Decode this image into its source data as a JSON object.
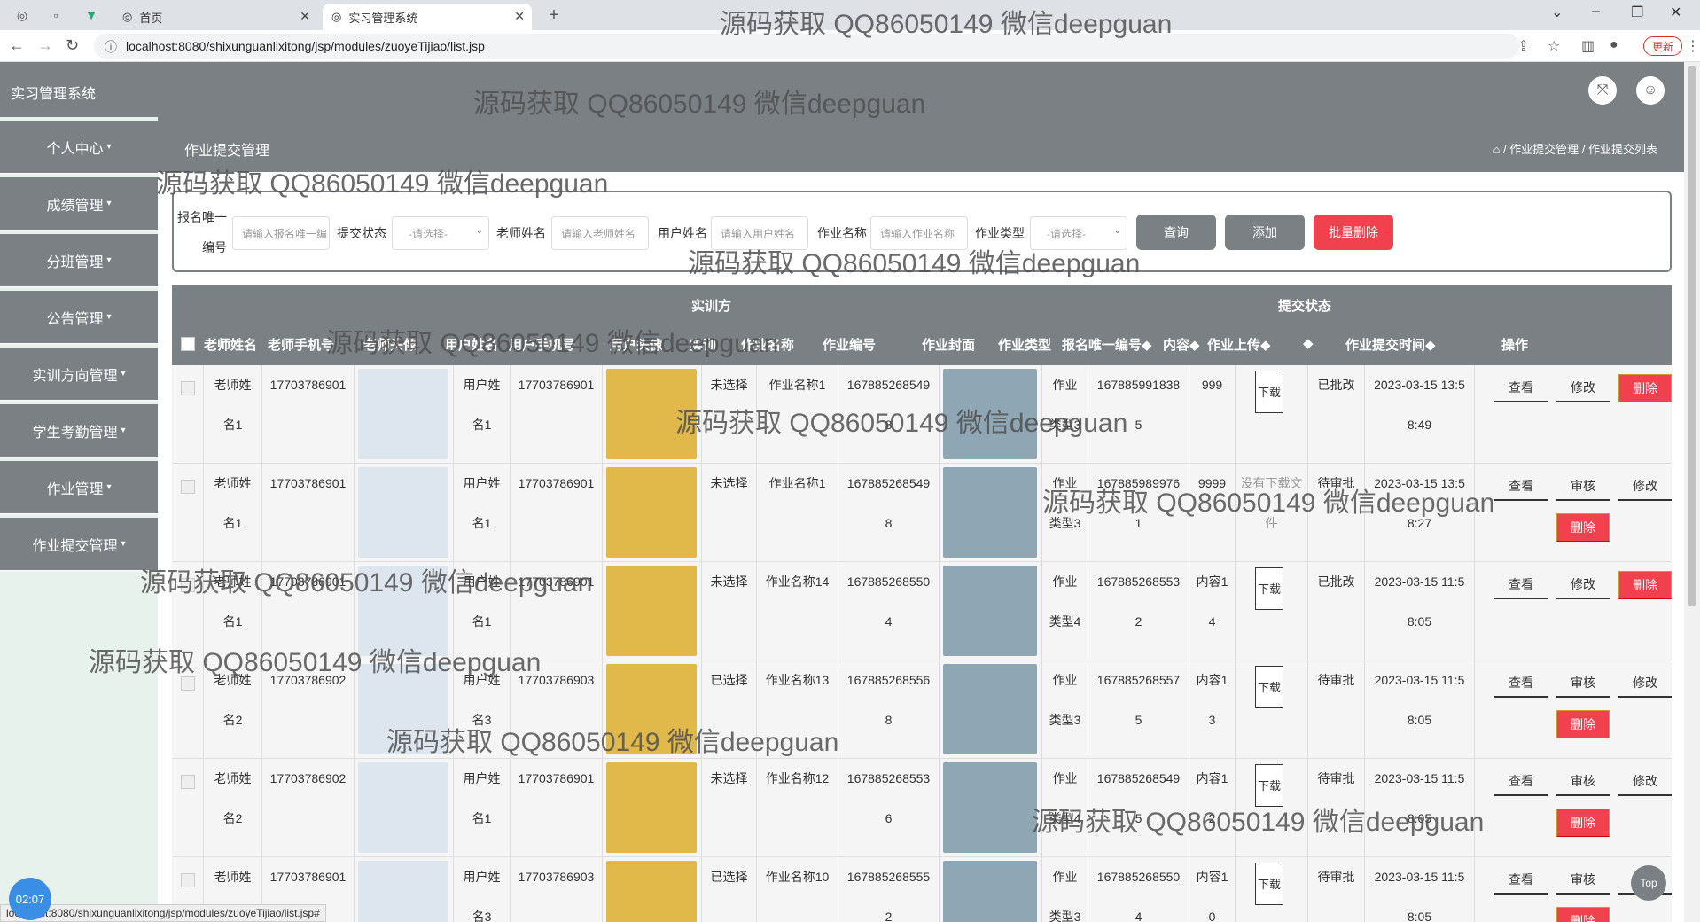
{
  "browser": {
    "tab1": "首页",
    "tab2": "实习管理系统",
    "url": "localhost:8080/shixunguanlixitong/jsp/modules/zuoyeTijiao/list.jsp",
    "update": "更新",
    "status_url": "localhost:8080/shixunguanlixitong/jsp/modules/zuoyeTijiao/list.jsp#"
  },
  "app": {
    "title": "实习管理系统"
  },
  "sidebar": {
    "items": [
      {
        "label": "个人中心"
      },
      {
        "label": "成绩管理"
      },
      {
        "label": "分班管理"
      },
      {
        "label": "公告管理"
      },
      {
        "label": "实训方向管理"
      },
      {
        "label": "学生考勤管理"
      },
      {
        "label": "作业管理"
      },
      {
        "label": "作业提交管理"
      }
    ]
  },
  "header": {
    "page_title": "作业提交管理",
    "breadcrumb": "/ 作业提交管理 / 作业提交列表"
  },
  "search": {
    "label_baoming": "报名唯一",
    "label_bianhao": "编号",
    "ph_baoming": "请输入报名唯一编",
    "label_status": "提交状态",
    "status_value": "-请选择-",
    "label_teacher": "老师姓名",
    "ph_teacher": "请输入老师姓名",
    "label_user": "用户姓名",
    "ph_user": "请输入用户姓名",
    "label_zuoye": "作业名称",
    "ph_zuoye": "请输入作业名称",
    "label_type": "作业类型",
    "type_value": "-请选择-",
    "btn_query": "查询",
    "btn_add": "添加",
    "btn_batch_delete": "批量删除"
  },
  "table": {
    "group_shixun": "实训方",
    "group_status": "提交状态",
    "headers": [
      "老师姓名",
      "老师手机号",
      "老师头像",
      "用户姓名",
      "用户手机号",
      "用户头像",
      "实训方向",
      "作业名称",
      "作业编号",
      "作业封面",
      "作业类型",
      "报名唯一编号",
      "内容",
      "作业上传",
      "",
      "作业提交时间",
      "操作"
    ],
    "rows": [
      {
        "teacher": "老师姓名1",
        "tphone": "17703786901",
        "user": "用户姓名1",
        "uphone": "17703786901",
        "dir": "未选择",
        "zname": "作业名称1",
        "zno": "1678852685498",
        "ztype": "作业类型3",
        "bno": "1678859918385",
        "content": "999",
        "upload": "下载",
        "status": "已批改",
        "time": "2023-03-15 13:58:49",
        "actions": [
          "查看",
          "修改",
          "删除"
        ]
      },
      {
        "teacher": "老师姓名1",
        "tphone": "17703786901",
        "user": "用户姓名1",
        "uphone": "17703786901",
        "dir": "未选择",
        "zname": "作业名称1",
        "zno": "1678852685498",
        "ztype": "作业类型3",
        "bno": "1678859899761",
        "content": "9999",
        "upload": "没有下载文件",
        "status": "待审批",
        "time": "2023-03-15 13:58:27",
        "actions": [
          "查看",
          "审核",
          "修改",
          "删除"
        ]
      },
      {
        "teacher": "老师姓名1",
        "tphone": "17703786901",
        "user": "用户姓名1",
        "uphone": "17703786901",
        "dir": "未选择",
        "zname": "作业名称14",
        "zno": "1678852685504",
        "ztype": "作业类型4",
        "bno": "1678852685532",
        "content": "内容14",
        "upload": "下载",
        "status": "已批改",
        "time": "2023-03-15 11:58:05",
        "actions": [
          "查看",
          "修改",
          "删除"
        ]
      },
      {
        "teacher": "老师姓名2",
        "tphone": "17703786902",
        "user": "用户姓名3",
        "uphone": "17703786903",
        "dir": "已选择",
        "zname": "作业名称13",
        "zno": "1678852685568",
        "ztype": "作业类型3",
        "bno": "1678852685575",
        "content": "内容13",
        "upload": "下载",
        "status": "待审批",
        "time": "2023-03-15 11:58:05",
        "actions": [
          "查看",
          "审核",
          "修改",
          "删除"
        ]
      },
      {
        "teacher": "老师姓名2",
        "tphone": "17703786902",
        "user": "用户姓名1",
        "uphone": "17703786901",
        "dir": "未选择",
        "zname": "作业名称12",
        "zno": "1678852685536",
        "ztype": "作业类型4",
        "bno": "1678852685495",
        "content": "内容12",
        "upload": "下载",
        "status": "待审批",
        "time": "2023-03-15 11:58:05",
        "actions": [
          "查看",
          "审核",
          "修改",
          "删除"
        ]
      },
      {
        "teacher": "老师姓名1",
        "tphone": "17703786901",
        "user": "用户姓名3",
        "uphone": "17703786903",
        "dir": "已选择",
        "zname": "作业名称10",
        "zno": "1678852685552",
        "ztype": "作业类型3",
        "bno": "1678852685504",
        "content": "内容10",
        "upload": "下载",
        "status": "待审批",
        "time": "2023-03-15 11:58:05",
        "actions": [
          "查看",
          "审核",
          "修改",
          "删除"
        ]
      }
    ]
  },
  "watermark": "源码获取 QQ86050149 微信deepguan",
  "clock": "02:07",
  "top_btn": "Top"
}
